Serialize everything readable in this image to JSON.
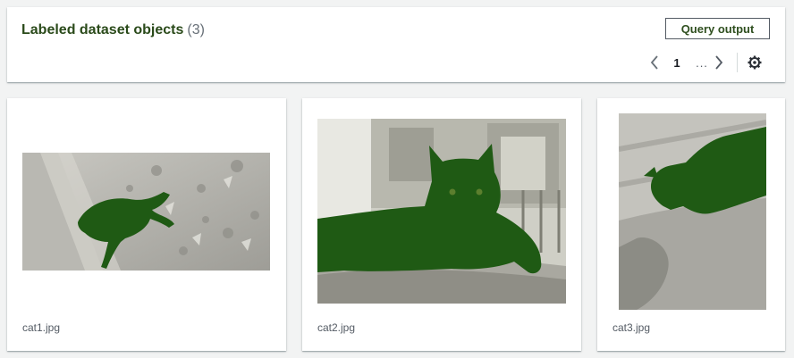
{
  "header": {
    "title": "Labeled dataset objects",
    "count": "(3)",
    "query_button": "Query output"
  },
  "pagination": {
    "current_page": "1",
    "ellipsis": "..."
  },
  "icons": {
    "prev": "chevron-left-icon",
    "next": "chevron-right-icon",
    "settings": "gear-icon"
  },
  "colors": {
    "label_mask": "#1f5a14",
    "title_text": "#2a4a1a"
  },
  "cards": [
    {
      "filename": "cat1.jpg"
    },
    {
      "filename": "cat2.jpg"
    },
    {
      "filename": "cat3.jpg"
    }
  ]
}
